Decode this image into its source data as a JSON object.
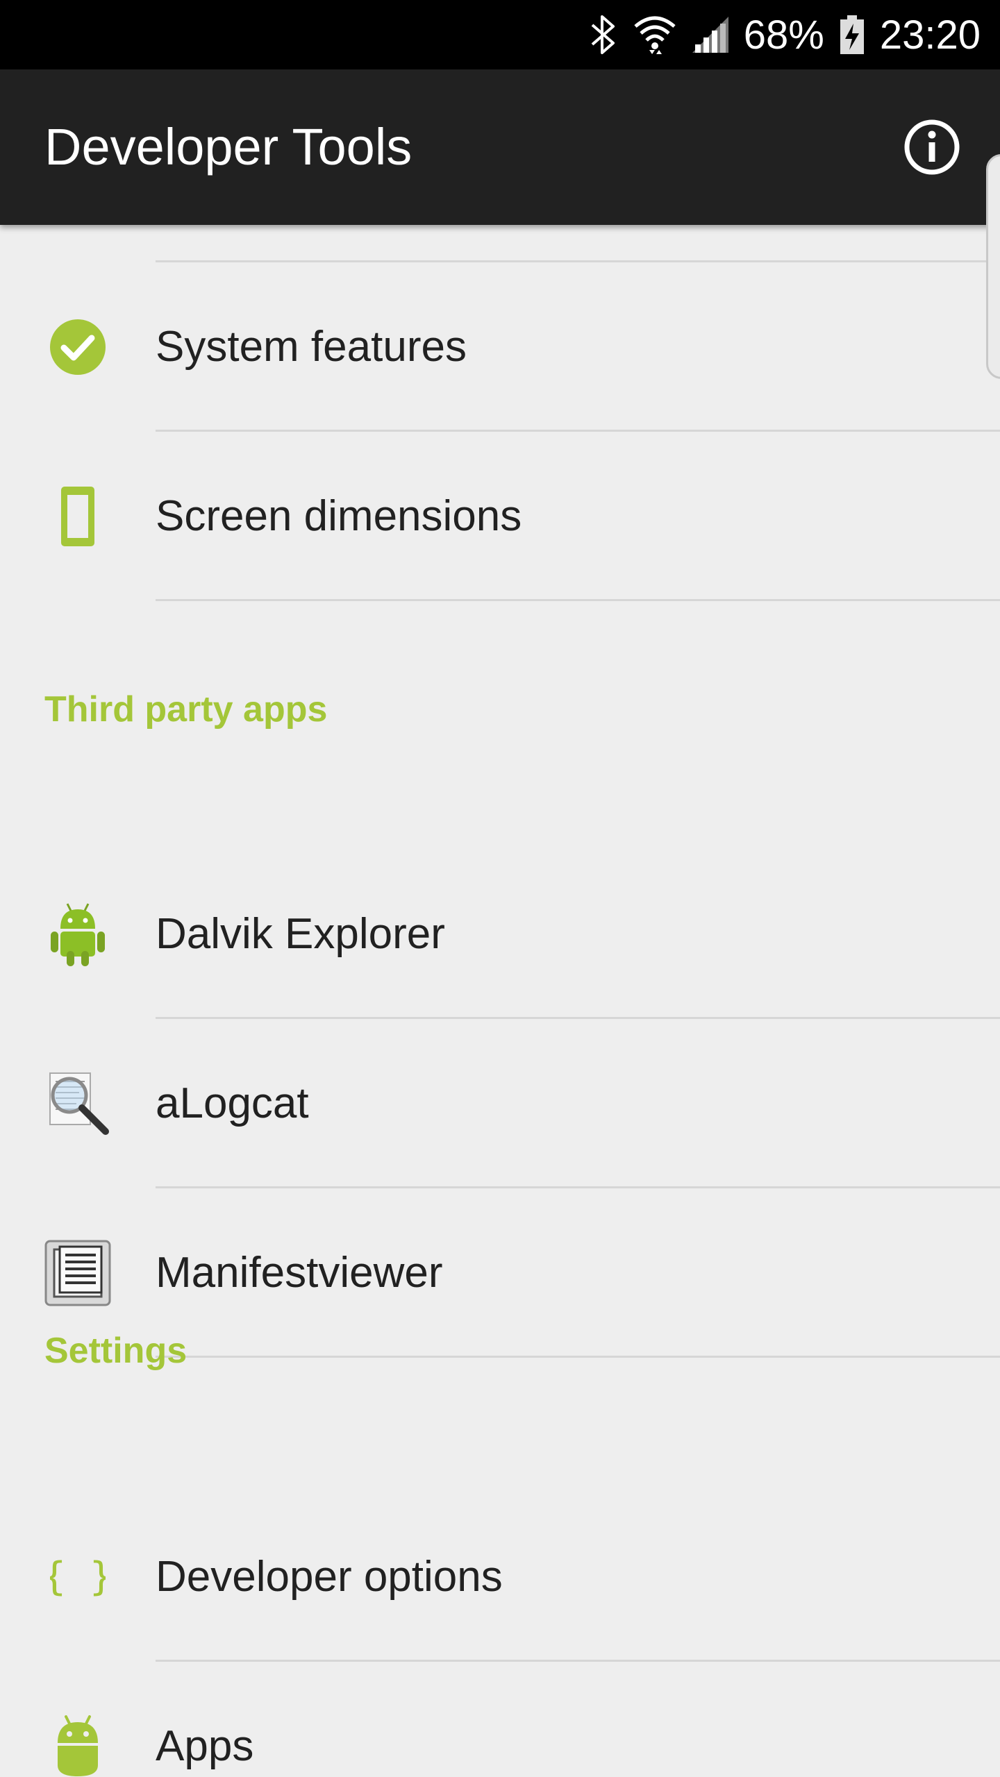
{
  "status_bar": {
    "battery": "68%",
    "time": "23:20"
  },
  "app_bar": {
    "title": "Developer Tools",
    "info_icon": "info-icon"
  },
  "sections": {
    "partial_item_icon": "device-icon",
    "system_items": [
      {
        "label": "System features",
        "icon": "check-circle-icon"
      },
      {
        "label": "Screen dimensions",
        "icon": "phone-outline-icon"
      }
    ],
    "third_party_header": "Third party apps",
    "third_party_items": [
      {
        "label": "Dalvik Explorer",
        "icon": "android-robot-icon"
      },
      {
        "label": "aLogcat",
        "icon": "magnifier-document-icon"
      },
      {
        "label": "Manifestviewer",
        "icon": "document-lines-icon"
      }
    ],
    "settings_header": "Settings",
    "settings_items": [
      {
        "label": "Developer options",
        "icon": "curly-braces-icon"
      },
      {
        "label": "Apps",
        "icon": "android-head-icon"
      }
    ]
  },
  "colors": {
    "accent": "#a4c639",
    "app_bar": "#212121",
    "status_bar": "#000000",
    "background": "#eeeeee"
  }
}
